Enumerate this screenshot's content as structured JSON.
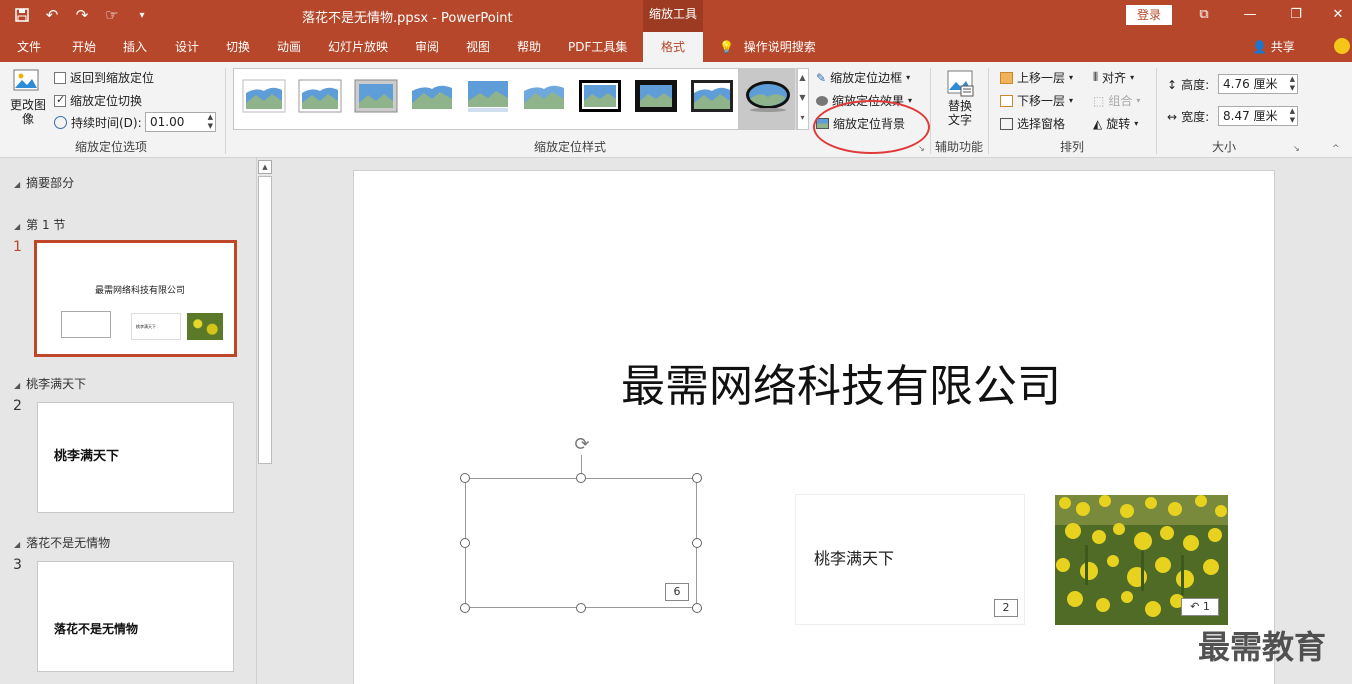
{
  "titlebar": {
    "doc_title": "落花不是无情物.ppsx  -  PowerPoint",
    "context_tab": "缩放工具",
    "login": "登录"
  },
  "tabs": [
    "文件",
    "开始",
    "插入",
    "设计",
    "切换",
    "动画",
    "幻灯片放映",
    "审阅",
    "视图",
    "帮助",
    "PDF工具集",
    "格式"
  ],
  "active_tab": "格式",
  "tell_me": "操作说明搜索",
  "share": "共享",
  "ribbon": {
    "change_image": "更改图像",
    "return_to_zoom": "返回到缩放定位",
    "zoom_transition": "缩放定位切换",
    "duration_label": "持续时间(D):",
    "duration_value": "01.00",
    "group_zoom_options": "缩放定位选项",
    "group_zoom_styles": "缩放定位样式",
    "zoom_border": "缩放定位边框",
    "zoom_effects": "缩放定位效果",
    "zoom_background": "缩放定位背景",
    "alt_text": "替换文字",
    "group_accessibility": "辅助功能",
    "bring_forward": "上移一层",
    "send_backward": "下移一层",
    "selection_pane": "选择窗格",
    "align": "对齐",
    "group": "组合",
    "rotate": "旋转",
    "group_arrange": "排列",
    "height_label": "高度:",
    "height_value": "4.76 厘米",
    "width_label": "宽度:",
    "width_value": "8.47 厘米",
    "group_size": "大小"
  },
  "sections": {
    "summary": "摘要部分",
    "section1": "第 1 节",
    "section2": "桃李满天下",
    "section3": "落花不是无情物"
  },
  "thumbnails": {
    "slide1_title": "最需网络科技有限公司",
    "slide1_card": "桃李满天下",
    "slide2_text": "桃李满天下",
    "slide3_text": "落花不是无情物",
    "nums": [
      "1",
      "2",
      "3"
    ]
  },
  "slide": {
    "title": "最需网络科技有限公司",
    "card_text": "桃李满天下",
    "badge_empty": "6",
    "badge_card": "2",
    "badge_photo": "1"
  },
  "watermark": "最需教育"
}
